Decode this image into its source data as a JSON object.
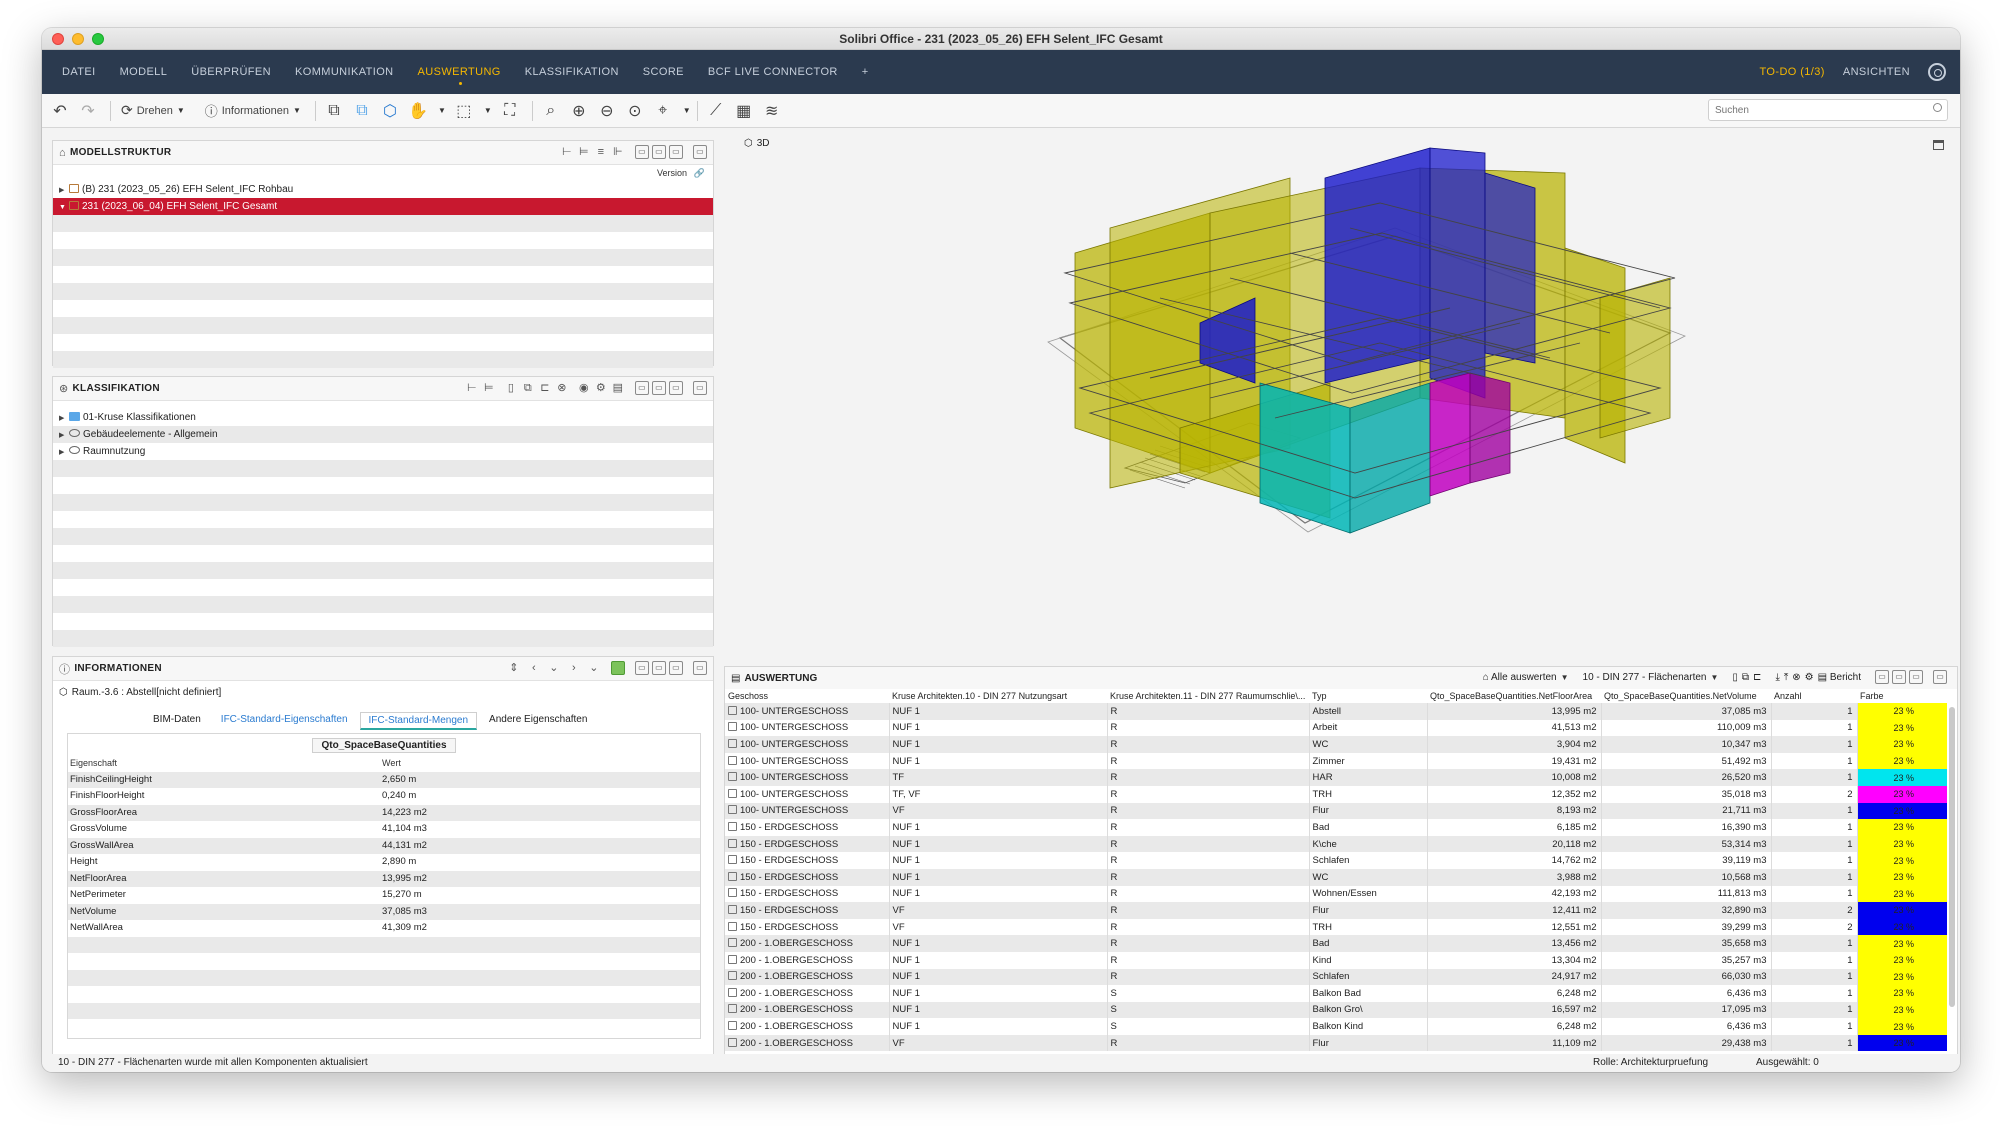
{
  "window": {
    "title": "Solibri Office - 231 (2023_05_26) EFH Selent_IFC Gesamt"
  },
  "menu": {
    "items": [
      "DATEI",
      "MODELL",
      "ÜBERPRÜFEN",
      "KOMMUNIKATION",
      "AUSWERTUNG",
      "KLASSIFIKATION",
      "SCORE",
      "BCF LIVE CONNECTOR",
      "+"
    ],
    "active_index": 4,
    "todo": "TO-DO (1/3)",
    "ansichten": "ANSICHTEN"
  },
  "toolbar": {
    "drehen": "Drehen",
    "informationen": "Informationen",
    "search_placeholder": "Suchen"
  },
  "modellstruktur": {
    "title": "MODELLSTRUKTUR",
    "version_label": "Version",
    "items": [
      {
        "label": "(B) 231 (2023_05_26) EFH Selent_IFC Rohbau",
        "selected": false
      },
      {
        "label": "231 (2023_06_04) EFH Selent_IFC Gesamt",
        "selected": true
      }
    ]
  },
  "klassifikation": {
    "title": "KLASSIFIKATION",
    "items": [
      "01-Kruse Klassifikationen",
      "Gebäudeelemente - Allgemein",
      "Raumnutzung"
    ]
  },
  "informationen": {
    "title": "INFORMATIONEN",
    "subtitle": "Raum.-3.6 : Abstell[nicht definiert]",
    "tabs": [
      "BIM-Daten",
      "IFC-Standard-Eigenschaften",
      "IFC-Standard-Mengen",
      "Andere Eigenschaften"
    ],
    "active_tab": 2,
    "set_name": "Qto_SpaceBaseQuantities",
    "col_property": "Eigenschaft",
    "col_value": "Wert",
    "properties": [
      {
        "name": "FinishCeilingHeight",
        "value": "2,650 m"
      },
      {
        "name": "FinishFloorHeight",
        "value": "0,240 m"
      },
      {
        "name": "GrossFloorArea",
        "value": "14,223 m2"
      },
      {
        "name": "GrossVolume",
        "value": "41,104 m3"
      },
      {
        "name": "GrossWallArea",
        "value": "44,131 m2"
      },
      {
        "name": "Height",
        "value": "2,890 m"
      },
      {
        "name": "NetFloorArea",
        "value": "13,995 m2"
      },
      {
        "name": "NetPerimeter",
        "value": "15,270 m"
      },
      {
        "name": "NetVolume",
        "value": "37,085 m3"
      },
      {
        "name": "NetWallArea",
        "value": "41,309 m2"
      }
    ]
  },
  "view3d": {
    "label": "3D"
  },
  "auswertung": {
    "title": "AUSWERTUNG",
    "alle_auswerten": "Alle auswerten",
    "preset": "10 - DIN 277 - Flächenarten",
    "bericht": "Bericht",
    "columns": [
      "Geschoss",
      "Kruse Architekten.10 - DIN 277 Nutzungsart",
      "Kruse Architekten.11 - DIN 277 Raumumschlie\\...",
      "Typ",
      "Qto_SpaceBaseQuantities.NetFloorArea",
      "Qto_SpaceBaseQuantities.NetVolume",
      "Anzahl",
      "Farbe"
    ],
    "rows": [
      [
        "100- UNTERGESCHOSS",
        "NUF 1",
        "R",
        "Abstell",
        "13,995 m2",
        "37,085 m3",
        "1",
        "23 %",
        "#ffff00"
      ],
      [
        "100- UNTERGESCHOSS",
        "NUF 1",
        "R",
        "Arbeit",
        "41,513 m2",
        "110,009 m3",
        "1",
        "23 %",
        "#ffff00"
      ],
      [
        "100- UNTERGESCHOSS",
        "NUF 1",
        "R",
        "WC",
        "3,904 m2",
        "10,347 m3",
        "1",
        "23 %",
        "#ffff00"
      ],
      [
        "100- UNTERGESCHOSS",
        "NUF 1",
        "R",
        "Zimmer",
        "19,431 m2",
        "51,492 m3",
        "1",
        "23 %",
        "#ffff00"
      ],
      [
        "100- UNTERGESCHOSS",
        "TF",
        "R",
        "HAR",
        "10,008 m2",
        "26,520 m3",
        "1",
        "23 %",
        "#00e5ee"
      ],
      [
        "100- UNTERGESCHOSS",
        "TF, VF",
        "R",
        "TRH",
        "12,352 m2",
        "35,018 m3",
        "2",
        "23 %",
        "#ff00ff"
      ],
      [
        "100- UNTERGESCHOSS",
        "VF",
        "R",
        "Flur",
        "8,193 m2",
        "21,711 m3",
        "1",
        "23 %",
        "#0000ee"
      ],
      [
        "150 - ERDGESCHOSS",
        "NUF 1",
        "R",
        "Bad",
        "6,185 m2",
        "16,390 m3",
        "1",
        "23 %",
        "#ffff00"
      ],
      [
        "150 - ERDGESCHOSS",
        "NUF 1",
        "R",
        "K\\che",
        "20,118 m2",
        "53,314 m3",
        "1",
        "23 %",
        "#ffff00"
      ],
      [
        "150 - ERDGESCHOSS",
        "NUF 1",
        "R",
        "Schlafen",
        "14,762 m2",
        "39,119 m3",
        "1",
        "23 %",
        "#ffff00"
      ],
      [
        "150 - ERDGESCHOSS",
        "NUF 1",
        "R",
        "WC",
        "3,988 m2",
        "10,568 m3",
        "1",
        "23 %",
        "#ffff00"
      ],
      [
        "150 - ERDGESCHOSS",
        "NUF 1",
        "R",
        "Wohnen/Essen",
        "42,193 m2",
        "111,813 m3",
        "1",
        "23 %",
        "#ffff00"
      ],
      [
        "150 - ERDGESCHOSS",
        "VF",
        "R",
        "Flur",
        "12,411 m2",
        "32,890 m3",
        "2",
        "23 %",
        "#0000ee"
      ],
      [
        "150 - ERDGESCHOSS",
        "VF",
        "R",
        "TRH",
        "12,551 m2",
        "39,299 m3",
        "2",
        "23 %",
        "#0000ee"
      ],
      [
        "200 - 1.OBERGESCHOSS",
        "NUF 1",
        "R",
        "Bad",
        "13,456 m2",
        "35,658 m3",
        "1",
        "23 %",
        "#ffff00"
      ],
      [
        "200 - 1.OBERGESCHOSS",
        "NUF 1",
        "R",
        "Kind",
        "13,304 m2",
        "35,257 m3",
        "1",
        "23 %",
        "#ffff00"
      ],
      [
        "200 - 1.OBERGESCHOSS",
        "NUF 1",
        "R",
        "Schlafen",
        "24,917 m2",
        "66,030 m3",
        "1",
        "23 %",
        "#ffff00"
      ],
      [
        "200 - 1.OBERGESCHOSS",
        "NUF 1",
        "S",
        "Balkon Bad",
        "6,248 m2",
        "6,436 m3",
        "1",
        "23 %",
        "#ffff00"
      ],
      [
        "200 - 1.OBERGESCHOSS",
        "NUF 1",
        "S",
        "Balkon Gro\\",
        "16,597 m2",
        "17,095 m3",
        "1",
        "23 %",
        "#ffff00"
      ],
      [
        "200 - 1.OBERGESCHOSS",
        "NUF 1",
        "S",
        "Balkon Kind",
        "6,248 m2",
        "6,436 m3",
        "1",
        "23 %",
        "#ffff00"
      ],
      [
        "200 - 1.OBERGESCHOSS",
        "VF",
        "R",
        "Flur",
        "11,109 m2",
        "29,438 m3",
        "1",
        "23 %",
        "#0000ee"
      ]
    ]
  },
  "status": {
    "message": "10 - DIN 277 - Flächenarten wurde mit allen Komponenten aktualisiert",
    "rolle": "Rolle: Architekturpruefung",
    "ausgewaehlt": "Ausgewählt: 0"
  },
  "colors": {
    "menubar": "#2b3a4f",
    "accent": "#f5b700",
    "selection": "#c8182f",
    "space_yellow": "#b8b300",
    "space_blue": "#1a1acc",
    "space_cyan": "#00b5b5",
    "space_magenta": "#c000c0"
  }
}
